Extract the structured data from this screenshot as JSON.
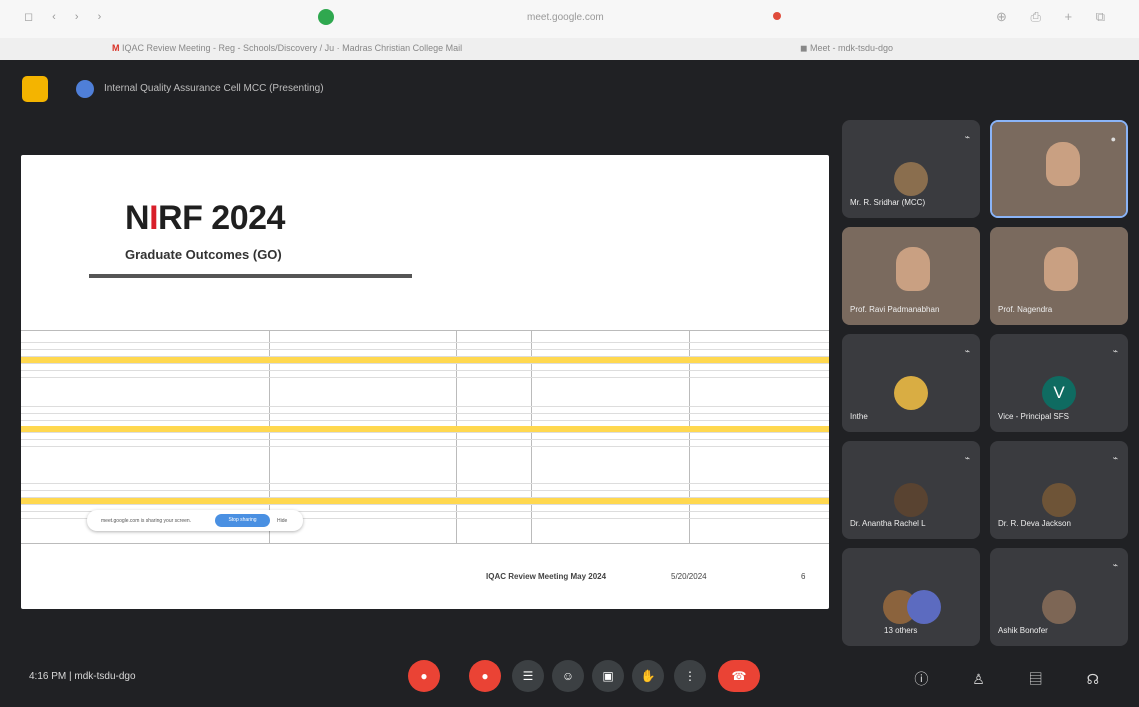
{
  "browser": {
    "url": "meet.google.com",
    "tab_active": "IQAC Review Meeting - Reg - Schools/Discovery / Ju · Madras Christian College Mail",
    "tab_meet": "Meet - mdk-tsdu-dgo"
  },
  "meeting": {
    "presentation_title": "Internal Quality Assurance Cell MCC (Presenting)",
    "time": "4:16 PM",
    "code": "mdk-tsdu-dgo"
  },
  "slide": {
    "title_prefix": "N",
    "title_i": "I",
    "title_rest": "RF 2024",
    "subtitle": "Graduate Outcomes (GO)",
    "footer_label": "IQAC Review Meeting May 2024",
    "footer_date": "5/20/2024",
    "page_number": "6"
  },
  "share_toast": {
    "message": "meet.google.com is sharing your screen.",
    "stop": "Stop sharing",
    "hide": "Hide"
  },
  "participants": [
    {
      "name": "Mr. R. Sridhar (MCC)"
    },
    {
      "name": ""
    },
    {
      "name": "Prof. Ravi Padmanabhan"
    },
    {
      "name": "Prof. Nagendra"
    },
    {
      "name": "Inthe"
    },
    {
      "name": "Vice - Principal SFS"
    },
    {
      "name": "Dr. Anantha Rachel L"
    },
    {
      "name": "Dr. R. Deva Jackson"
    },
    {
      "name": "13 others"
    },
    {
      "name": "Ashik Bonofer"
    }
  ],
  "controls": {
    "more_icon": "more-options-icon",
    "end_call_icon": "call-end-icon"
  },
  "icons": {
    "mic": "mic-icon",
    "camera": "camera-icon",
    "captions": "captions-icon",
    "emoji": "emoji-icon",
    "present": "present-icon",
    "hand": "raise-hand-icon",
    "info": "info-icon",
    "people": "people-icon",
    "chat": "chat-icon",
    "activities": "activities-icon"
  },
  "colors": {
    "meet_bg": "#202124",
    "tile_bg": "#3a3b3f",
    "accent": "#8ab4f8",
    "danger": "#ea4335",
    "highlight": "#ffd84f"
  }
}
